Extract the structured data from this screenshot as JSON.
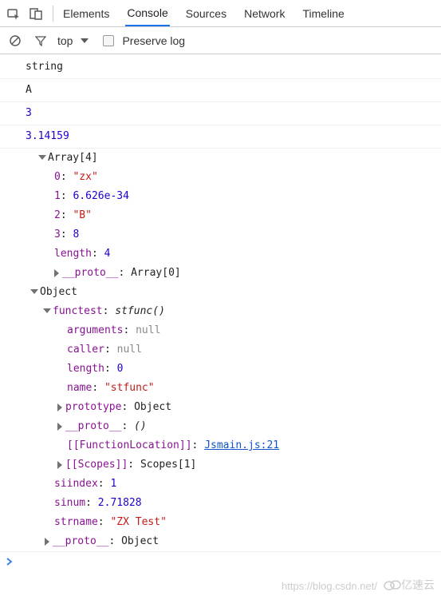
{
  "tabs": {
    "elements": "Elements",
    "console": "Console",
    "sources": "Sources",
    "network": "Network",
    "timeline": "Timeline"
  },
  "toolbar": {
    "context": "top",
    "preserve_log": "Preserve log"
  },
  "log": {
    "l1": "string",
    "l2": "A",
    "l3": "3",
    "l4": "3.14159",
    "array_header": "Array[4]",
    "a0k": "0",
    "a0v": "\"zx\"",
    "a1k": "1",
    "a1v": "6.626e-34",
    "a2k": "2",
    "a2v": "\"B\"",
    "a3k": "3",
    "a3v": "8",
    "alenk": "length",
    "alenv": "4",
    "aproto_k": "__proto__",
    "aproto_v": "Array[0]",
    "obj_header": "Object",
    "functest_k": "functest",
    "functest_v": "stfunc()",
    "arguments_k": "arguments",
    "arguments_v": "null",
    "caller_k": "caller",
    "caller_v": "null",
    "flen_k": "length",
    "flen_v": "0",
    "fname_k": "name",
    "fname_v": "\"stfunc\"",
    "proto_k": "prototype",
    "proto_v": "Object",
    "fproto_k": "__proto__",
    "fproto_v": "()",
    "funloc_k": "[[FunctionLocation]]",
    "funloc_v": "Jsmain.js:21",
    "scopes_k": "[[Scopes]]",
    "scopes_v": "Scopes[1]",
    "siindex_k": "siindex",
    "siindex_v": "1",
    "sinum_k": "sinum",
    "sinum_v": "2.71828",
    "strname_k": "strname",
    "strname_v": "\"ZX Test\"",
    "oproto_k": "__proto__",
    "oproto_v": "Object"
  },
  "footer": {
    "url": "https://blog.csdn.net/",
    "logo": "亿速云"
  }
}
